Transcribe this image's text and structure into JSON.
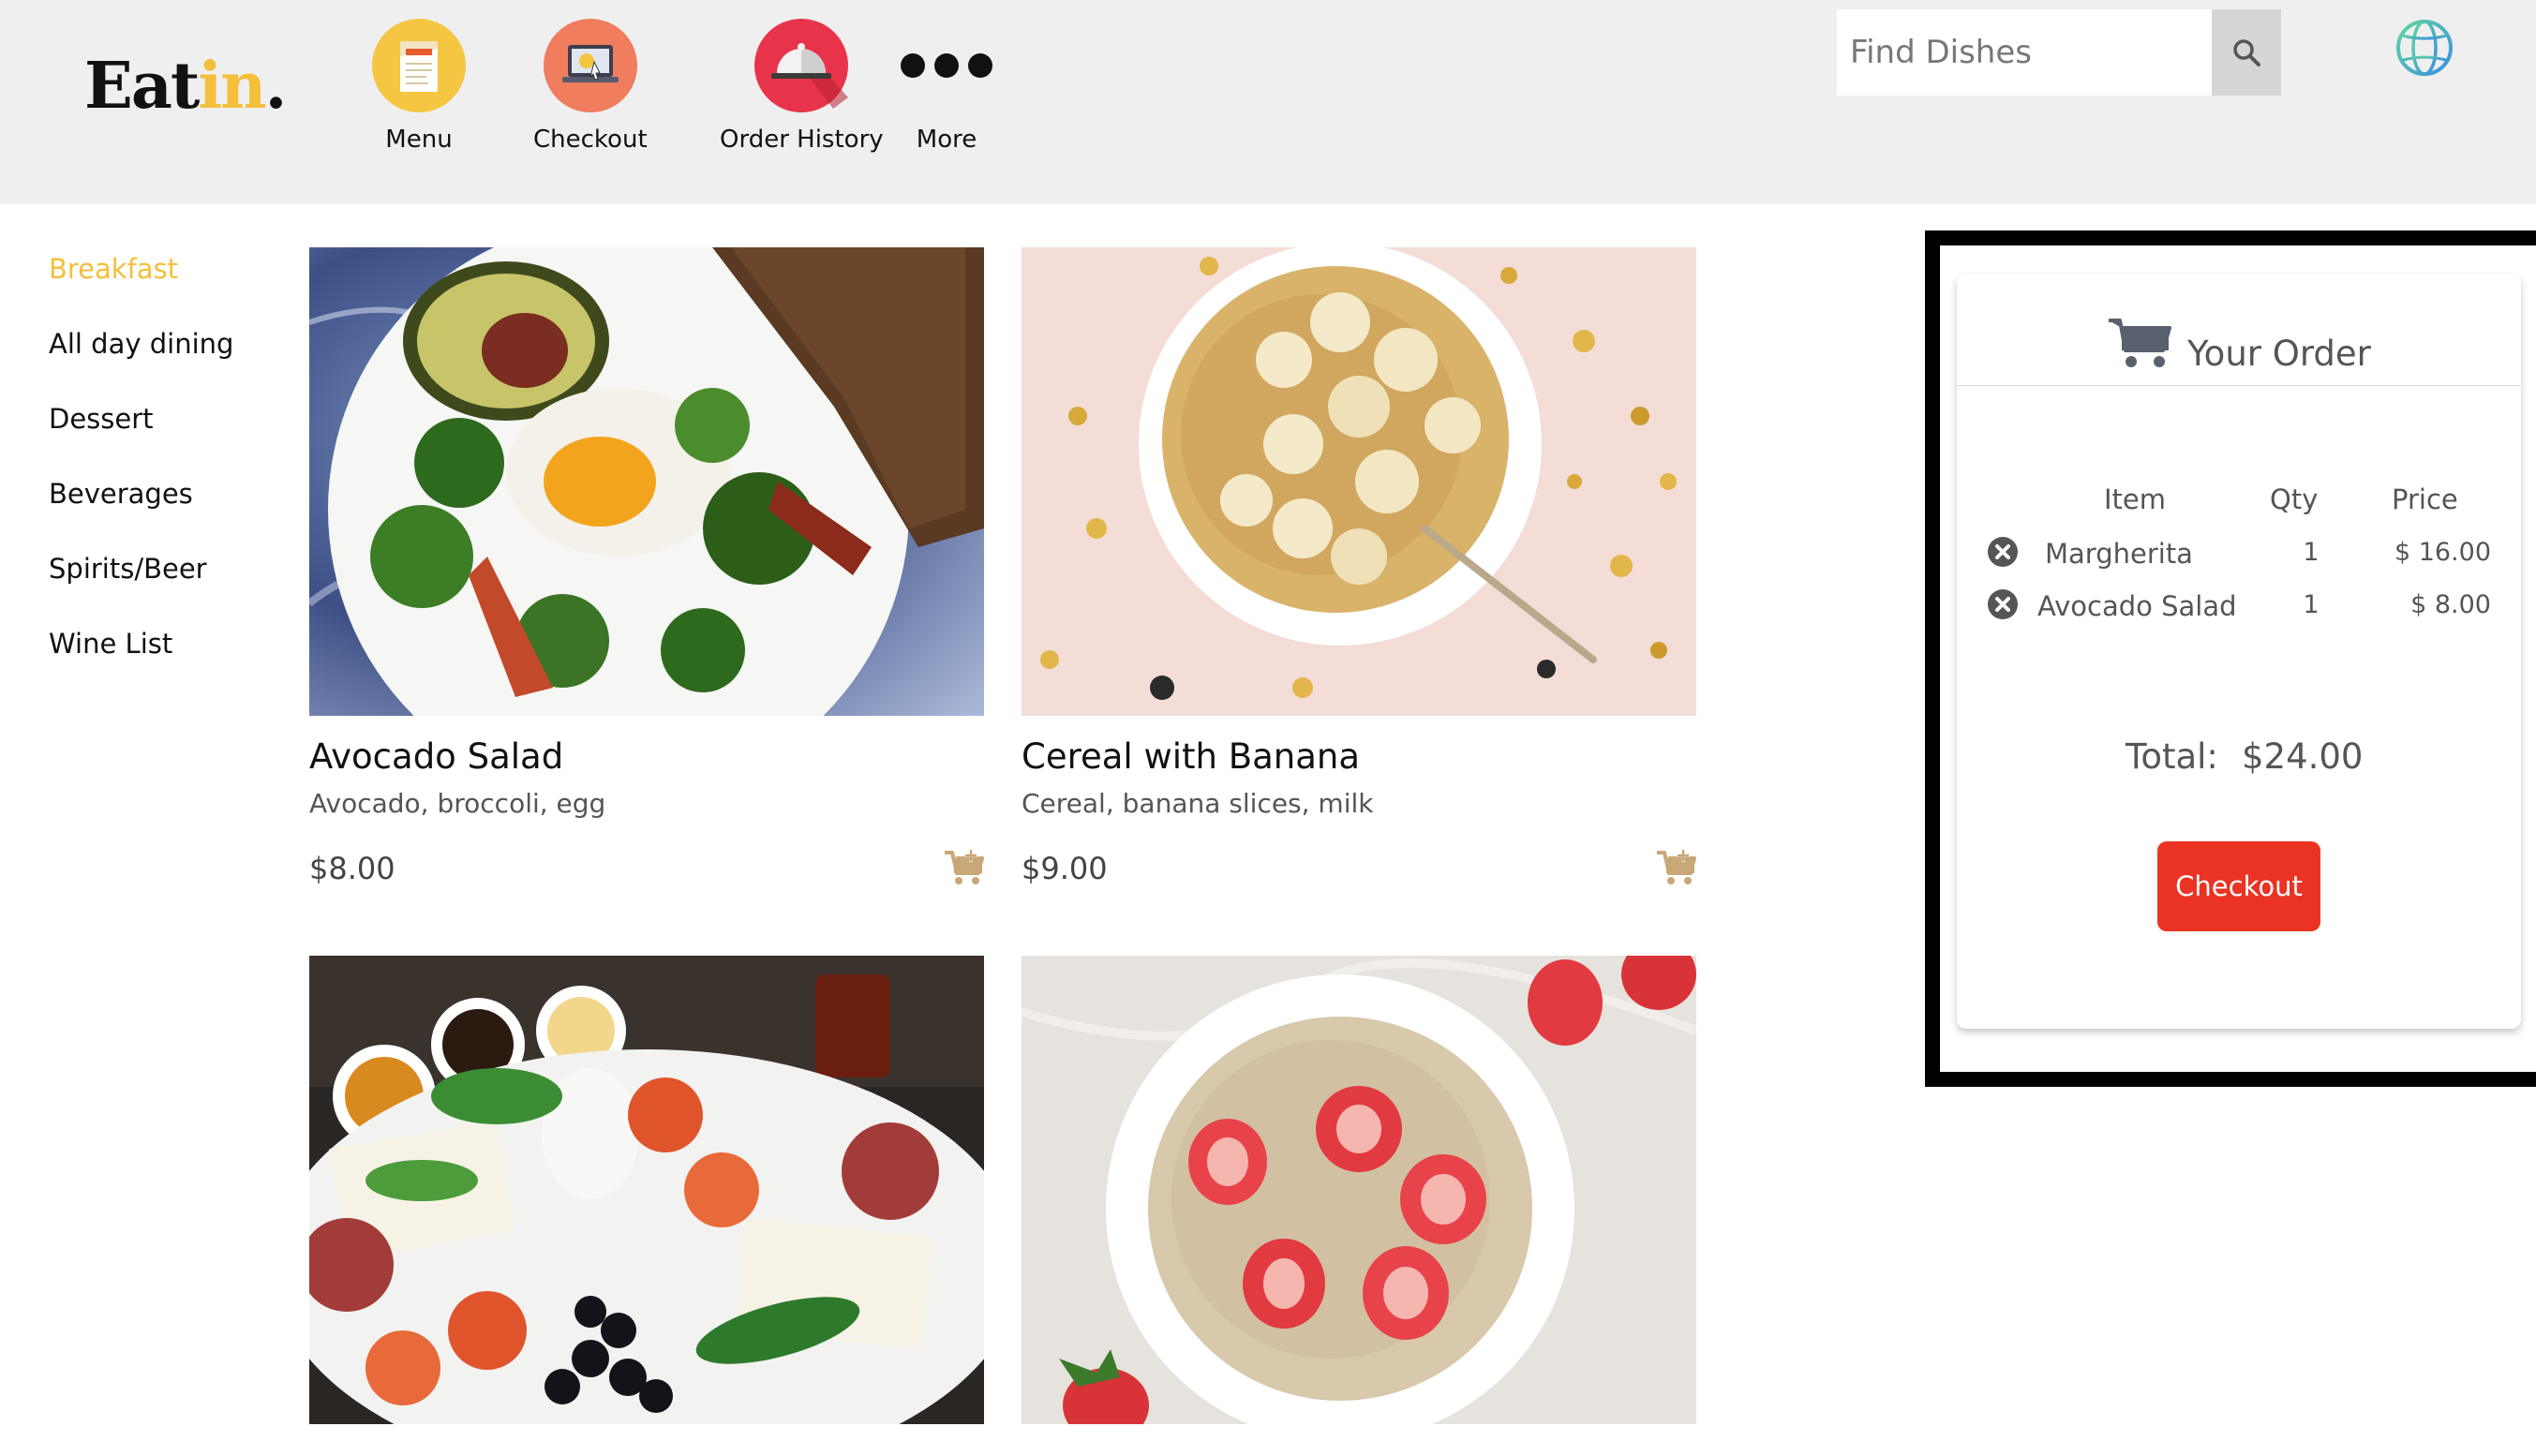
{
  "brand": {
    "name_main": "Eat",
    "name_accent": "in",
    "name_dot": "."
  },
  "nav": [
    {
      "label": "Menu",
      "icon": "menu-card-icon"
    },
    {
      "label": "Checkout",
      "icon": "laptop-payment-icon"
    },
    {
      "label": "Order History",
      "icon": "cloche-icon"
    },
    {
      "label": "More",
      "icon": "more-dots-icon"
    }
  ],
  "search": {
    "placeholder": "Find Dishes",
    "value": "",
    "icon": "search-icon"
  },
  "language": {
    "icon": "globe-icon"
  },
  "sidebar": {
    "items": [
      {
        "label": "Breakfast",
        "active": true
      },
      {
        "label": "All day dining"
      },
      {
        "label": "Dessert"
      },
      {
        "label": "Beverages"
      },
      {
        "label": "Spirits/Beer"
      },
      {
        "label": "Wine List"
      }
    ]
  },
  "dishes": [
    {
      "name": "Avocado Salad",
      "description": "Avocado, broccoli, egg",
      "price": "$8.00"
    },
    {
      "name": "Cereal with Banana",
      "description": "Cereal, banana slices, milk",
      "price": "$9.00"
    },
    {
      "name": "",
      "description": "",
      "price": ""
    },
    {
      "name": "",
      "description": "",
      "price": ""
    }
  ],
  "order": {
    "title": "Your Order",
    "columns": {
      "item": "Item",
      "qty": "Qty",
      "price": "Price"
    },
    "rows": [
      {
        "item": "Margherita",
        "qty": "1",
        "price": "$ 16.00"
      },
      {
        "item": "Avocado Salad",
        "qty": "1",
        "price": "$ 8.00"
      }
    ],
    "total_label": "Total:",
    "total_value": "$24.00",
    "checkout_label": "Checkout"
  },
  "colors": {
    "accent": "#f4bf3a",
    "checkout": "#ea3323",
    "header_bg": "#efefef"
  }
}
